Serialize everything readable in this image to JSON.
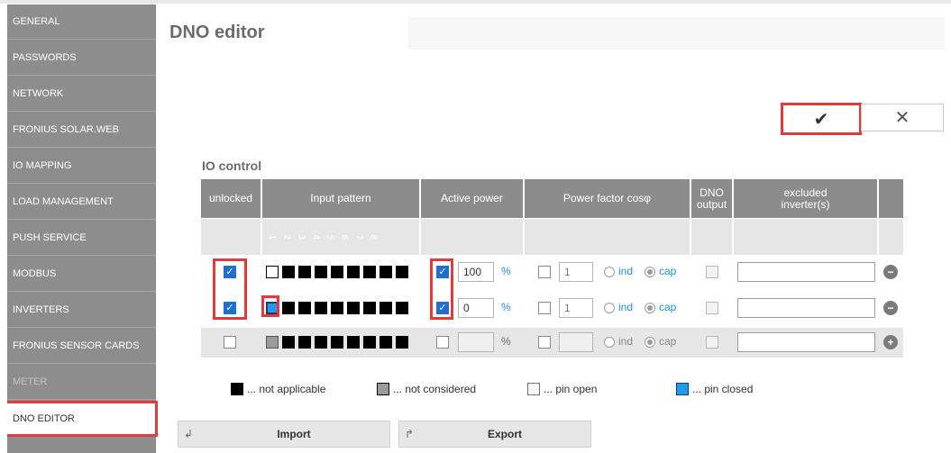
{
  "sidebar": {
    "items": [
      {
        "label": "GENERAL"
      },
      {
        "label": "PASSWORDS"
      },
      {
        "label": "NETWORK"
      },
      {
        "label": "FRONIUS SOLAR.WEB"
      },
      {
        "label": "IO MAPPING"
      },
      {
        "label": "LOAD MANAGEMENT"
      },
      {
        "label": "PUSH SERVICE"
      },
      {
        "label": "MODBUS"
      },
      {
        "label": "INVERTERS"
      },
      {
        "label": "FRONIUS SENSOR CARDS"
      },
      {
        "label": "METER"
      },
      {
        "label": "DNO EDITOR"
      }
    ]
  },
  "page": {
    "title": "DNO editor",
    "confirm_glyph": "✔",
    "cancel_glyph": "✕"
  },
  "io_control": {
    "title": "IO control",
    "headers": {
      "unlocked": "unlocked",
      "input_pattern": "Input pattern",
      "active_power": "Active power",
      "power_factor": "Power factor cosφ",
      "dno_output_1": "DNO",
      "dno_output_2": "output",
      "excluded_1": "excluded",
      "excluded_2": "inverter(s)"
    },
    "pin_numbers": [
      "1",
      "2",
      "3",
      "4",
      "5",
      "6",
      "7",
      "8"
    ],
    "rows": [
      {
        "active_power": "100",
        "unit": "%",
        "pf": "1",
        "ind": "ind",
        "cap": "cap"
      },
      {
        "active_power": "0",
        "unit": "%",
        "pf": "1",
        "ind": "ind",
        "cap": "cap"
      },
      {
        "active_power": "",
        "unit": "%",
        "pf": "",
        "ind": "ind",
        "cap": "cap"
      }
    ],
    "row_buttons": [
      "−",
      "−",
      "+"
    ]
  },
  "legend": {
    "not_applicable": "... not applicable",
    "not_considered": "... not considered",
    "pin_open": "... pin open",
    "pin_closed": "... pin closed"
  },
  "actions": {
    "import_label": "Import",
    "export_label": "Export",
    "import_icon": "↲",
    "export_icon": "↱"
  },
  "colors": {
    "highlight": "#e03a3a",
    "accent": "#1e8fd8",
    "header_gray": "#8c8c8c"
  }
}
